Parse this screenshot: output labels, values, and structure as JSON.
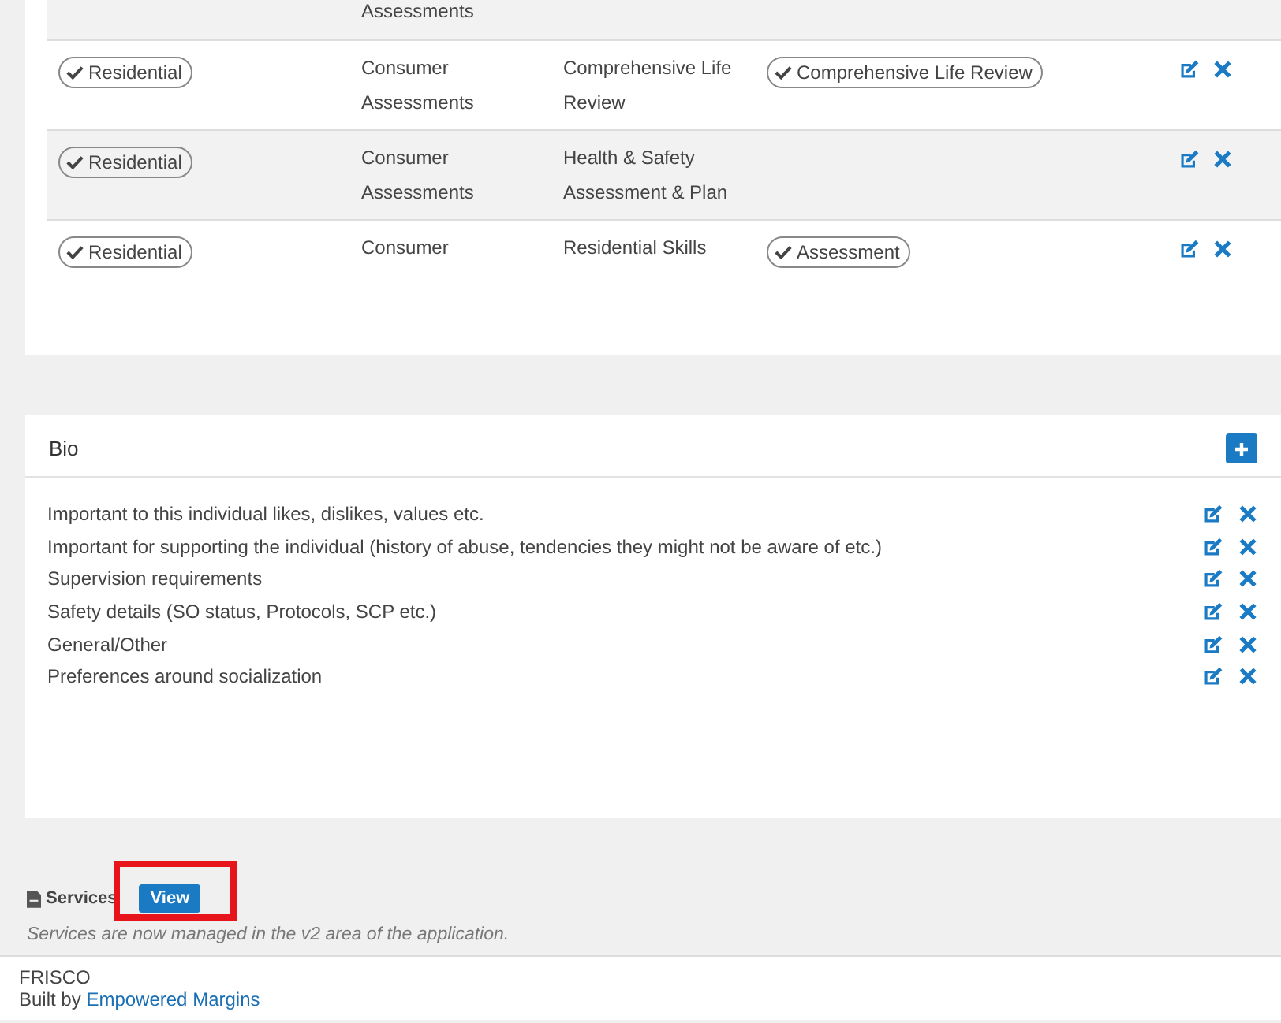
{
  "assessments": {
    "rows": [
      {
        "shaded": true,
        "category": "",
        "type": "Assessments",
        "name": "",
        "tag": null
      },
      {
        "shaded": false,
        "category": "Residential",
        "type": "Consumer Assessments",
        "name": "Comprehensive Life Review",
        "tag": "Comprehensive Life Review"
      },
      {
        "shaded": true,
        "category": "Residential",
        "type": "Consumer Assessments",
        "name": "Health & Safety Assessment & Plan",
        "tag": null
      },
      {
        "shaded": false,
        "category": "Residential",
        "type": "Consumer",
        "name": "Residential Skills",
        "tag": "Assessment"
      }
    ]
  },
  "bio": {
    "title": "Bio",
    "items": [
      "Important to this individual likes, dislikes, values etc.",
      "Important for supporting the individual (history of abuse, tendencies they might not be aware of etc.)",
      "Supervision requirements",
      "Safety details (SO status, Protocols, SCP etc.)",
      "General/Other",
      "Preferences around socialization"
    ]
  },
  "services": {
    "label": "Services",
    "button": "View",
    "highlighted": true,
    "note": "Services are now managed in the v2 area of the application."
  },
  "footer": {
    "app": "FRISCO",
    "built_by": "Built by",
    "link": "Empowered Margins"
  }
}
